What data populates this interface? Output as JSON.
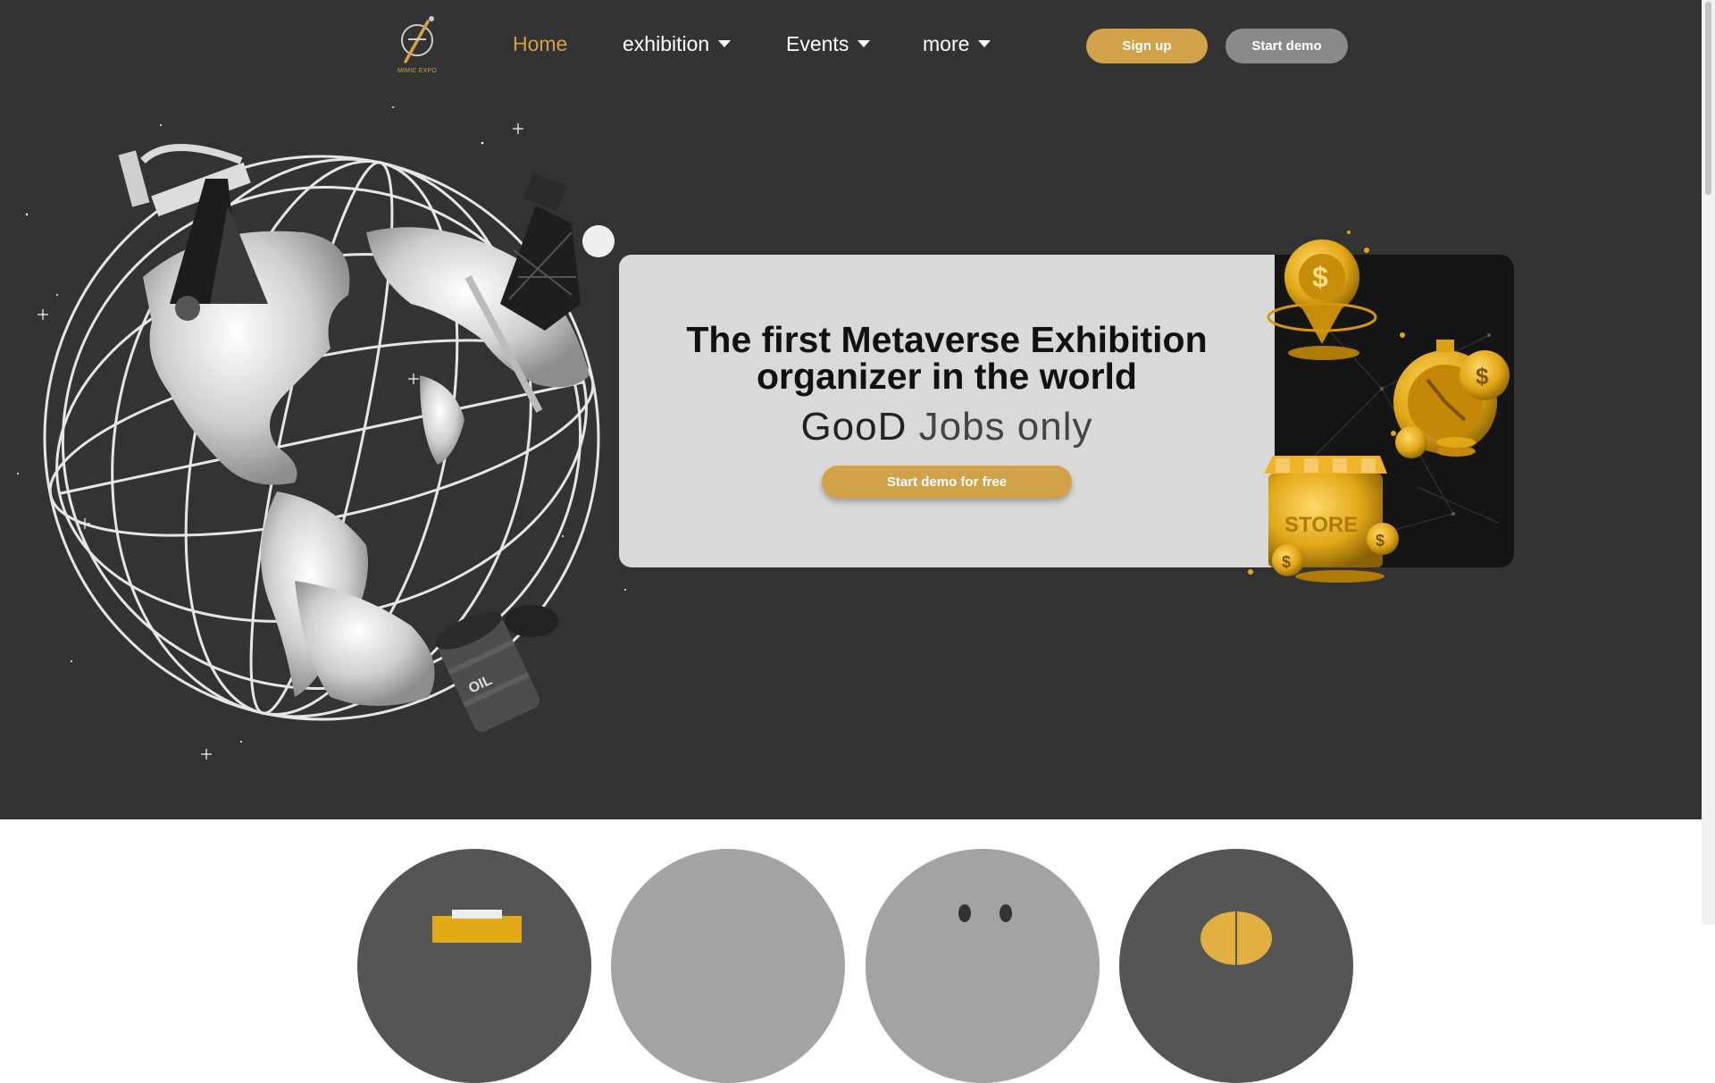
{
  "logo": {
    "text": "MIMIC EXPO",
    "icon": "mimic-expo-logo"
  },
  "nav": {
    "items": [
      {
        "label": "Home",
        "active": true,
        "dropdown": false
      },
      {
        "label": "exhibition",
        "active": false,
        "dropdown": true
      },
      {
        "label": "Events",
        "active": false,
        "dropdown": true
      },
      {
        "label": "more",
        "active": false,
        "dropdown": true
      }
    ],
    "signup_label": "Sign up",
    "demo_label": "Start demo"
  },
  "hero": {
    "headline_line1": "The first Metaverse Exhibition",
    "headline_line2": "organizer in the world",
    "tagline_brand": "GooD",
    "tagline_rest": "Jobs only",
    "cta_label": "Start demo for free",
    "store_label": "STORE"
  },
  "features": {
    "circles": [
      {
        "icon": "store-icon",
        "color": "#555555"
      },
      {
        "icon": "blank-icon",
        "color": "#a3a3a3"
      },
      {
        "icon": "face-icon",
        "color": "#a3a3a3"
      },
      {
        "icon": "globe-icon",
        "color": "#555555"
      }
    ]
  },
  "colors": {
    "background_dark": "#333333",
    "accent_gold": "#d1a24a",
    "button_gray": "#8a8a8a",
    "card_light": "#d9d9d9"
  }
}
